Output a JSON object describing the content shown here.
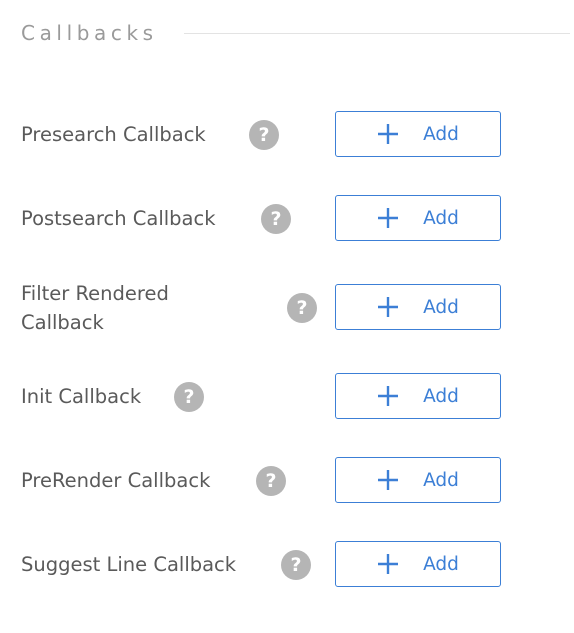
{
  "section": {
    "title": "Callbacks"
  },
  "callbacks": [
    {
      "label": "Presearch Callback",
      "help_glyph": "?",
      "add_label": "Add"
    },
    {
      "label": "Postsearch Callback",
      "help_glyph": "?",
      "add_label": "Add"
    },
    {
      "label": "Filter Rendered Callback",
      "help_glyph": "?",
      "add_label": "Add"
    },
    {
      "label": "Init Callback",
      "help_glyph": "?",
      "add_label": "Add"
    },
    {
      "label": "PreRender Callback",
      "help_glyph": "?",
      "add_label": "Add"
    },
    {
      "label": "Suggest Line Callback",
      "help_glyph": "?",
      "add_label": "Add"
    }
  ],
  "icons": {
    "help": "question-mark-circle-icon",
    "add": "plus-icon"
  },
  "colors": {
    "accent": "#3c7fd6",
    "help_icon_bg": "#b5b5b5",
    "label_text": "#5a5a5a",
    "section_title": "#9a9a9a"
  }
}
